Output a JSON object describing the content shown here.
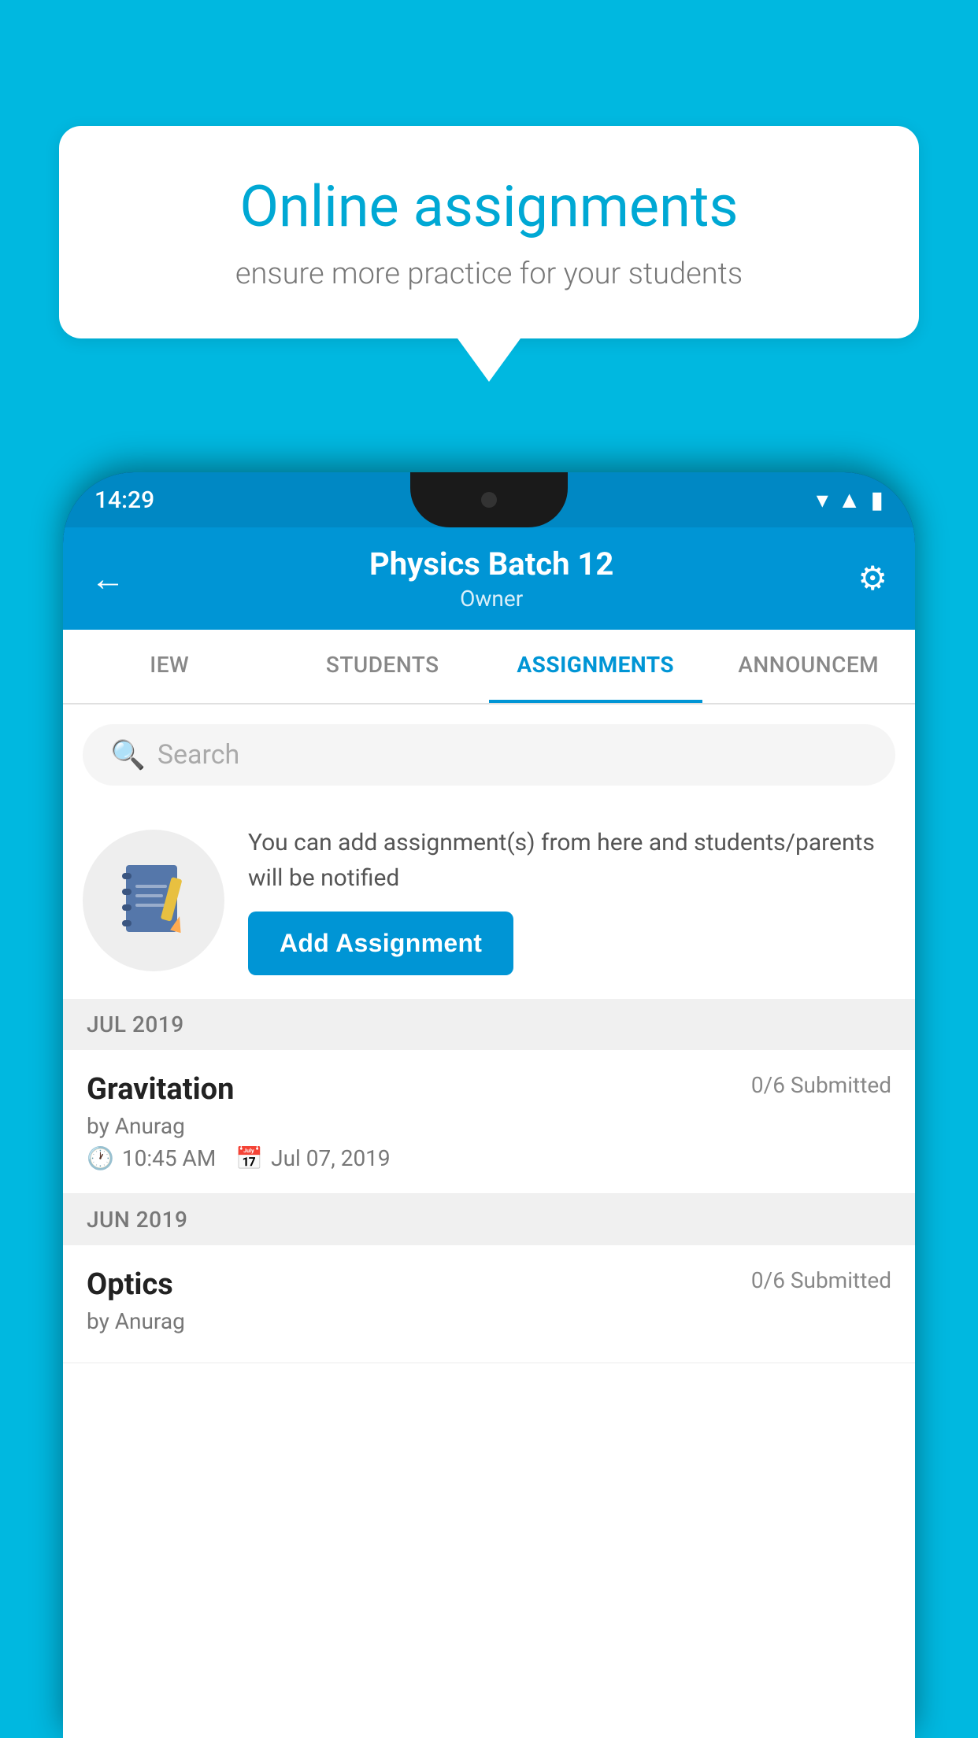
{
  "background_color": "#00b8e0",
  "speech_bubble": {
    "title": "Online assignments",
    "subtitle": "ensure more practice for your students"
  },
  "status_bar": {
    "time": "14:29",
    "icons": [
      "wifi",
      "signal",
      "battery"
    ]
  },
  "app_header": {
    "title": "Physics Batch 12",
    "subtitle": "Owner",
    "back_label": "←",
    "settings_label": "⚙"
  },
  "tabs": [
    {
      "label": "IEW",
      "active": false
    },
    {
      "label": "STUDENTS",
      "active": false
    },
    {
      "label": "ASSIGNMENTS",
      "active": true
    },
    {
      "label": "ANNOUNCEM",
      "active": false
    }
  ],
  "search": {
    "placeholder": "Search"
  },
  "info_section": {
    "description": "You can add assignment(s) from here and students/parents will be notified",
    "add_button_label": "Add Assignment"
  },
  "months": [
    {
      "label": "JUL 2019",
      "assignments": [
        {
          "name": "Gravitation",
          "submitted": "0/6 Submitted",
          "by": "by Anurag",
          "time": "10:45 AM",
          "date": "Jul 07, 2019"
        }
      ]
    },
    {
      "label": "JUN 2019",
      "assignments": [
        {
          "name": "Optics",
          "submitted": "0/6 Submitted",
          "by": "by Anurag",
          "time": "",
          "date": ""
        }
      ]
    }
  ]
}
